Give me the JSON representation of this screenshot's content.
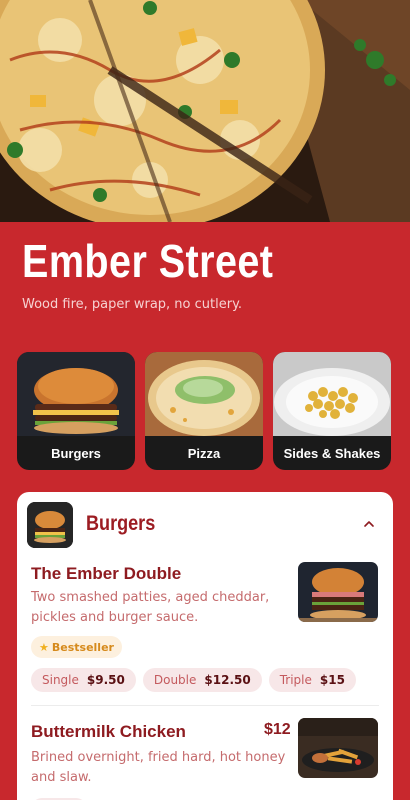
{
  "brand": {
    "title": "Ember Street",
    "tagline": "Wood fire, paper wrap, no cutlery."
  },
  "categories": [
    {
      "label": "Burgers",
      "icon": "burger-photo"
    },
    {
      "label": "Pizza",
      "icon": "pizza-photo"
    },
    {
      "label": "Sides & Shakes",
      "icon": "sides-photo"
    }
  ],
  "section": {
    "title": "Burgers",
    "toggle_icon": "chevron-up-icon"
  },
  "items": [
    {
      "name": "The Ember Double",
      "desc_line1": "Two smashed patties, aged cheddar,",
      "desc_line2": "pickles and burger sauce.",
      "badge": "Bestseller",
      "badge_icon": "star-icon",
      "options": [
        {
          "name": "Single",
          "price": "$9.50"
        },
        {
          "name": "Double",
          "price": "$12.50"
        },
        {
          "name": "Triple",
          "price": "$15"
        }
      ]
    },
    {
      "name": "Buttermilk Chicken",
      "price": "$12",
      "desc_line1": "Brined overnight, fried hard, hot honey",
      "desc_line2": "and slaw."
    }
  ],
  "colors": {
    "background": "#c8282d",
    "accent": "#8e1b20",
    "badge": "#d68a1c",
    "chip": "#f7e7e8"
  }
}
